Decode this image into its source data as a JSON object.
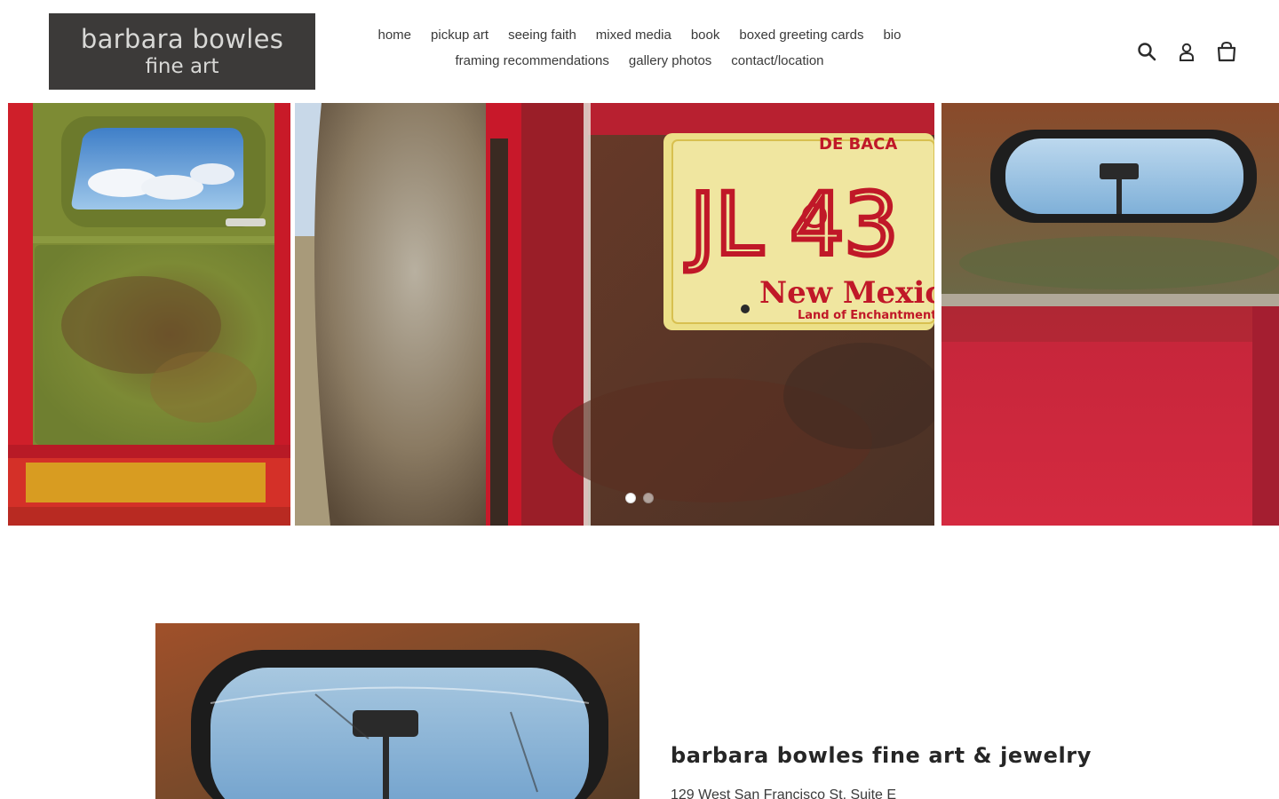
{
  "header": {
    "logo": {
      "line1": "barbara bowles",
      "line2": "fine art"
    },
    "nav_rows": [
      [
        "home",
        "pickup art",
        "seeing faith",
        "mixed media",
        "book",
        "boxed greeting cards",
        "bio"
      ],
      [
        "framing recommendations",
        "gallery photos",
        "contact/location"
      ]
    ],
    "icons": [
      "search-icon",
      "account-icon",
      "cart-icon"
    ]
  },
  "slideshow": {
    "slides_count": 2,
    "active_index": 0,
    "plate": {
      "county": "DE BACA",
      "number": "JL 43",
      "state": "New Mexic",
      "motto": "Land of Enchantment"
    }
  },
  "feature": {
    "title": "barbara bowles fine art & jewelry",
    "address": "129 West San Francisco St, Suite E"
  },
  "colors": {
    "logo_bg": "#3c3a39",
    "logo_text": "#d8d8d6",
    "truck_red": "#c8102e",
    "rust": "#8a4a2a",
    "olive_green": "#7a8a3a"
  }
}
